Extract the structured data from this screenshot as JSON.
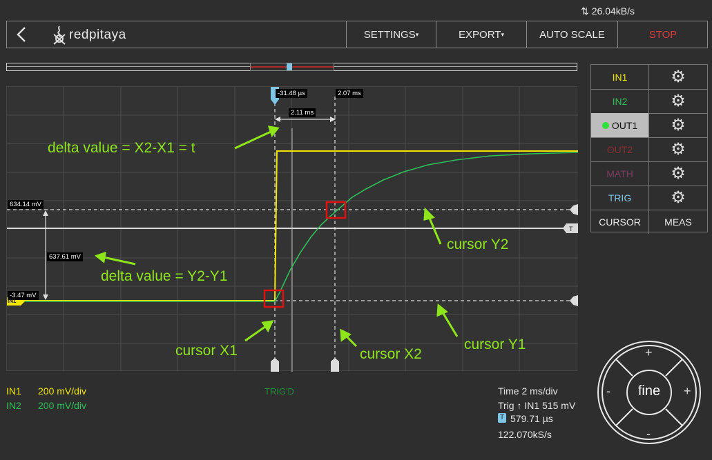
{
  "status": {
    "data_rate": "26.04kB/s"
  },
  "topbar": {
    "brand": "redpitaya",
    "settings_label": "SETTINGS",
    "export_label": "EXPORT",
    "autoscale_label": "AUTO SCALE",
    "stop_label": "STOP"
  },
  "cursors": {
    "x1_time": "-31.48 µs",
    "x2_time": "2.07 ms",
    "delta_x": "2.11 ms",
    "y2_value": "634.14 mV",
    "delta_y": "637.61 mV",
    "y1_value": "-3.47 mV",
    "trigger_marker": "T",
    "ch_marker": "IN1"
  },
  "annotations": {
    "delta_x_note": "delta value = X2-X1 = t",
    "delta_y_note": "delta value = Y2-Y1",
    "cursor_y2": "cursor Y2",
    "cursor_y1": "cursor Y1",
    "cursor_x1": "cursor X1",
    "cursor_x2": "cursor X2"
  },
  "panel": {
    "rows": [
      {
        "name": "IN1",
        "color": "#f2e600"
      },
      {
        "name": "IN2",
        "color": "#2fbf58"
      },
      {
        "name": "OUT1",
        "color": "#ffffff"
      },
      {
        "name": "OUT2",
        "color": "#8b2e2e"
      },
      {
        "name": "MATH",
        "color": "#7a3b62"
      },
      {
        "name": "TRIG",
        "color": "#7ec6e8"
      }
    ],
    "cursor_label": "CURSOR",
    "meas_label": "MEAS"
  },
  "bottom": {
    "in1_label": "IN1",
    "in1_scale": "200 mV/div",
    "in2_label": "IN2",
    "in2_scale": "200 mV/div",
    "trig_status": "TRIG'D",
    "time_div": "Time 2 ms/div",
    "trig_info_prefix": "Trig",
    "trig_info": "IN1 515 mV",
    "trig_time": "579.71 µs",
    "sample_rate": "122.070kS/s"
  },
  "control": {
    "center_label": "fine",
    "plus": "+",
    "minus": "-"
  },
  "colors": {
    "in1": "#f2e600",
    "in2": "#2fbf58",
    "stop": "#e03a3a",
    "trig": "#7ec6e8",
    "annotation": "#8ee51a"
  }
}
